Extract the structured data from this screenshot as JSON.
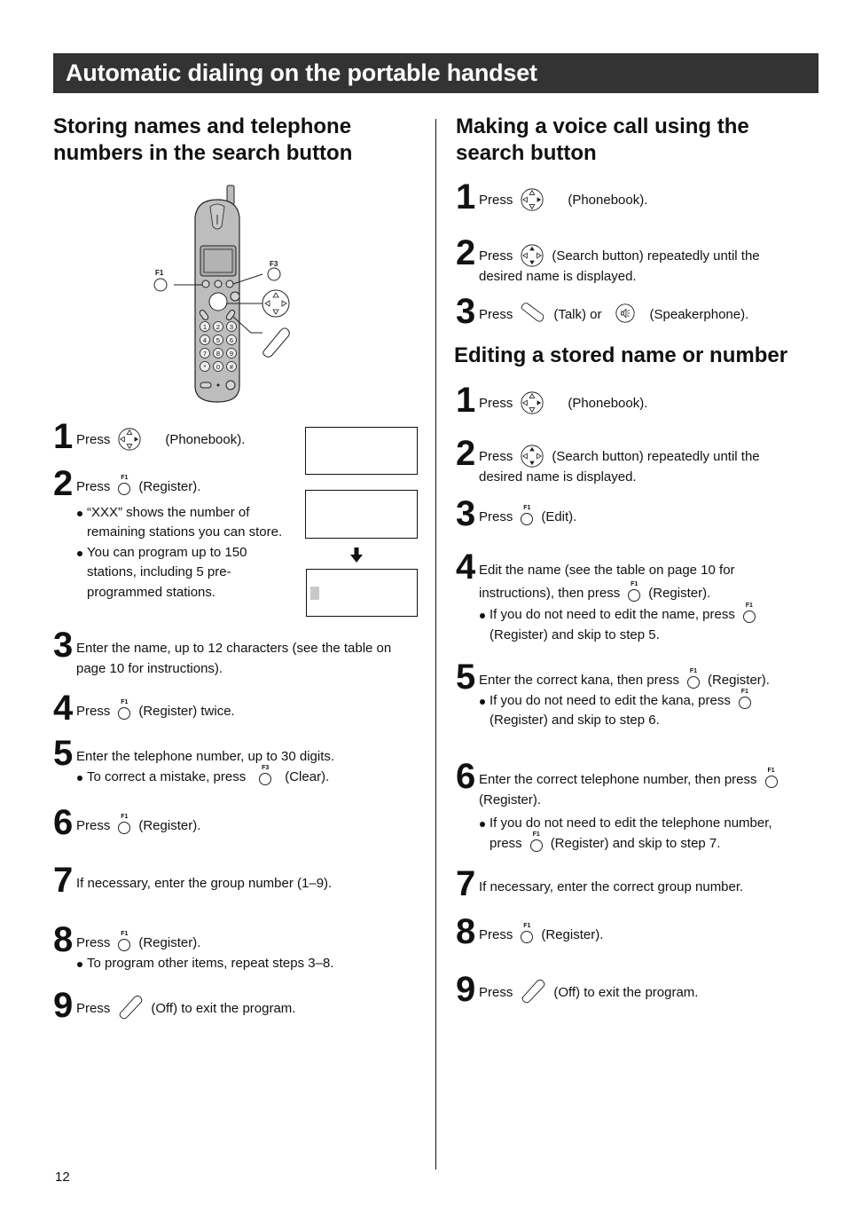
{
  "page": {
    "banner_title": "Automatic dialing on the portable handset",
    "page_number": "12"
  },
  "icons": {
    "navigator": "navigator-key-icon",
    "f1": "f1-key-icon",
    "f3": "f3-key-icon",
    "talk": "talk-key-icon",
    "speaker": "speakerphone-key-icon",
    "off": "off-key-icon",
    "f1_label": "F1",
    "f3_label": "F3"
  },
  "left": {
    "heading": "Storing names and telephone numbers in the search button",
    "illustration": {
      "f1_callout": "F1",
      "f3_callout": "F3",
      "keypad": [
        "1",
        "2",
        "3",
        "4",
        "5",
        "6",
        "7",
        "8",
        "9",
        "*",
        "0",
        "#"
      ]
    },
    "steps": [
      {
        "num": "1",
        "pre": "Press",
        "post": "(Phonebook)."
      },
      {
        "num": "2",
        "pre": "Press",
        "post": "(Register).",
        "bullets": [
          "“XXX” shows the number of remaining stations you can store.",
          "You can program up to 150 stations, including 5 pre-programmed stations."
        ]
      },
      {
        "num": "3",
        "text": "Enter the name, up to 12 characters (see the table on page 10 for instructions)."
      },
      {
        "num": "4",
        "pre": "Press",
        "post": "(Register) twice."
      },
      {
        "num": "5",
        "text": "Enter the telephone number, up to 30 digits.",
        "bullet_pre": "To correct a mistake, press",
        "bullet_post": "(Clear)."
      },
      {
        "num": "6",
        "pre": "Press",
        "post": "(Register)."
      },
      {
        "num": "7",
        "text": "If necessary, enter the group number (1–9)."
      },
      {
        "num": "8",
        "pre": "Press",
        "post": "(Register).",
        "bullet": "To program other items, repeat steps 3–8."
      },
      {
        "num": "9",
        "pre": "Press",
        "post": "(Off) to exit the program."
      }
    ]
  },
  "right": {
    "voice_heading": "Making a voice call using the search button",
    "voice_steps": [
      {
        "num": "1",
        "pre": "Press",
        "post": "(Phonebook)."
      },
      {
        "num": "2",
        "pre": "Press",
        "post": "(Search button) repeatedly until the",
        "cont": "desired name is displayed."
      },
      {
        "num": "3",
        "pre": "Press",
        "mid": "(Talk) or",
        "post": "(Speakerphone)."
      }
    ],
    "edit_heading": "Editing a stored name or number",
    "edit_steps": [
      {
        "num": "1",
        "pre": "Press",
        "post": "(Phonebook)."
      },
      {
        "num": "2",
        "pre": "Press",
        "post": "(Search button) repeatedly until the",
        "cont": "desired name is displayed."
      },
      {
        "num": "3",
        "pre": "Press",
        "post": "(Edit)."
      },
      {
        "num": "4",
        "line1": "Edit the name (see the table on page 10 for",
        "line2_pre": "instructions), then press",
        "line2_post": "(Register).",
        "bullet_pre": "If you do not need to edit the name, press",
        "bullet_post": "(Register) and skip to step 5."
      },
      {
        "num": "5",
        "pre": "Enter the correct kana, then press",
        "post": "(Register).",
        "bullet_pre": "If you do not need to edit the kana, press",
        "bullet_post": "(Register) and skip to step 6."
      },
      {
        "num": "6",
        "pre": "Enter the correct telephone number, then press",
        "post": "(Register).",
        "bullet_line1": "If you do not need to edit the telephone number,",
        "bullet_pre": "press",
        "bullet_post": "(Register) and skip to step 7."
      },
      {
        "num": "7",
        "text": "If necessary, enter the correct group number."
      },
      {
        "num": "8",
        "pre": "Press",
        "post": "(Register)."
      },
      {
        "num": "9",
        "pre": "Press",
        "post": "(Off) to exit the program."
      }
    ]
  }
}
